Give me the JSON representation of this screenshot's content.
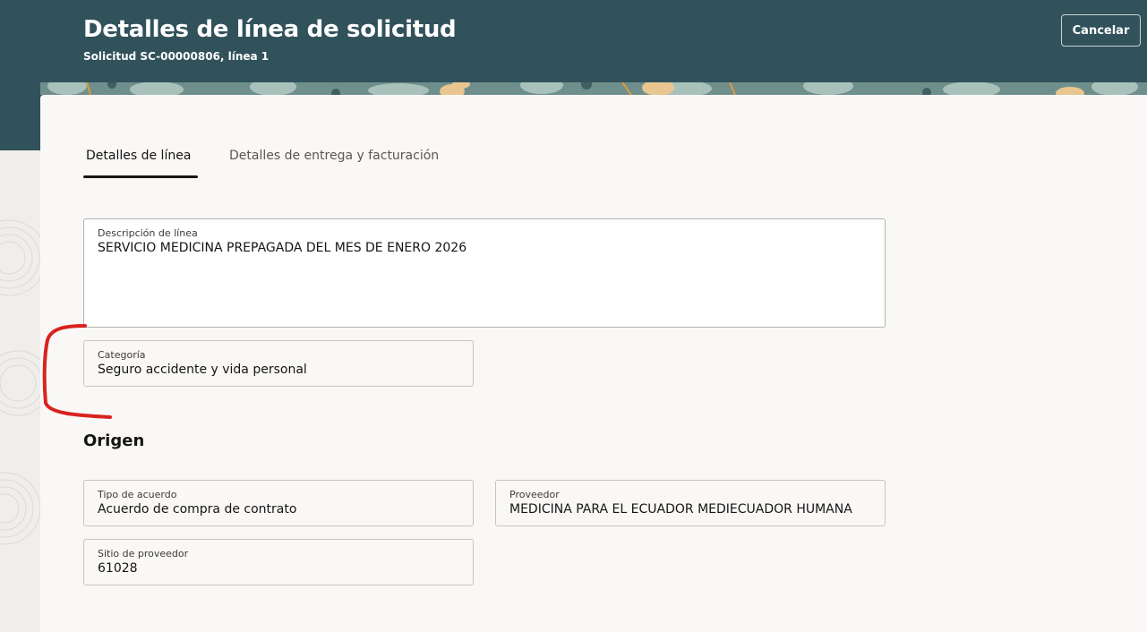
{
  "header": {
    "title": "Detalles de línea de solicitud",
    "subtitle": "Solicitud SC-00000806, línea 1",
    "cancel_label": "Cancelar"
  },
  "tabs": [
    {
      "label": "Detalles de línea",
      "active": true
    },
    {
      "label": "Detalles de entrega y facturación",
      "active": false
    }
  ],
  "fields": {
    "line_description": {
      "label": "Descripción de línea",
      "value": "SERVICIO MEDICINA PREPAGADA DEL MES DE ENERO 2026"
    },
    "category": {
      "label": "Categoría",
      "value": "Seguro accidente y vida personal"
    }
  },
  "origin": {
    "title": "Origen",
    "agreement_type": {
      "label": "Tipo de acuerdo",
      "value": "Acuerdo de compra de contrato"
    },
    "supplier": {
      "label": "Proveedor",
      "value": "MEDICINA PARA EL ECUADOR MEDIECUADOR HUMANA"
    },
    "supplier_site": {
      "label": "Sitio de proveedor",
      "value": "61028"
    }
  },
  "colors": {
    "header_bg": "#31525b",
    "card_bg": "#f9f8f6",
    "annotation": "#d9231f"
  }
}
